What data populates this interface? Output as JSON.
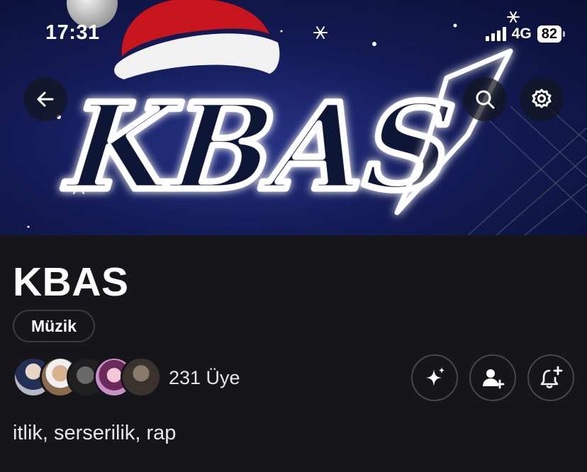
{
  "status_bar": {
    "time": "17:31",
    "network": "4G",
    "battery": "82"
  },
  "banner": {
    "logo_text": "KBAS"
  },
  "group": {
    "name": "KBAS",
    "category": "Müzik",
    "member_count": "231 Üye",
    "description": "itlik, serserilik, rap"
  },
  "icons": {
    "back": "arrow-left-icon",
    "search": "search-icon",
    "settings": "gear-icon",
    "ai": "sparkle-icon",
    "invite": "add-user-icon",
    "notify": "bell-plus-icon"
  },
  "colors": {
    "background": "#16161a",
    "banner": "#141c58",
    "santa_hat": "#c8141c"
  }
}
